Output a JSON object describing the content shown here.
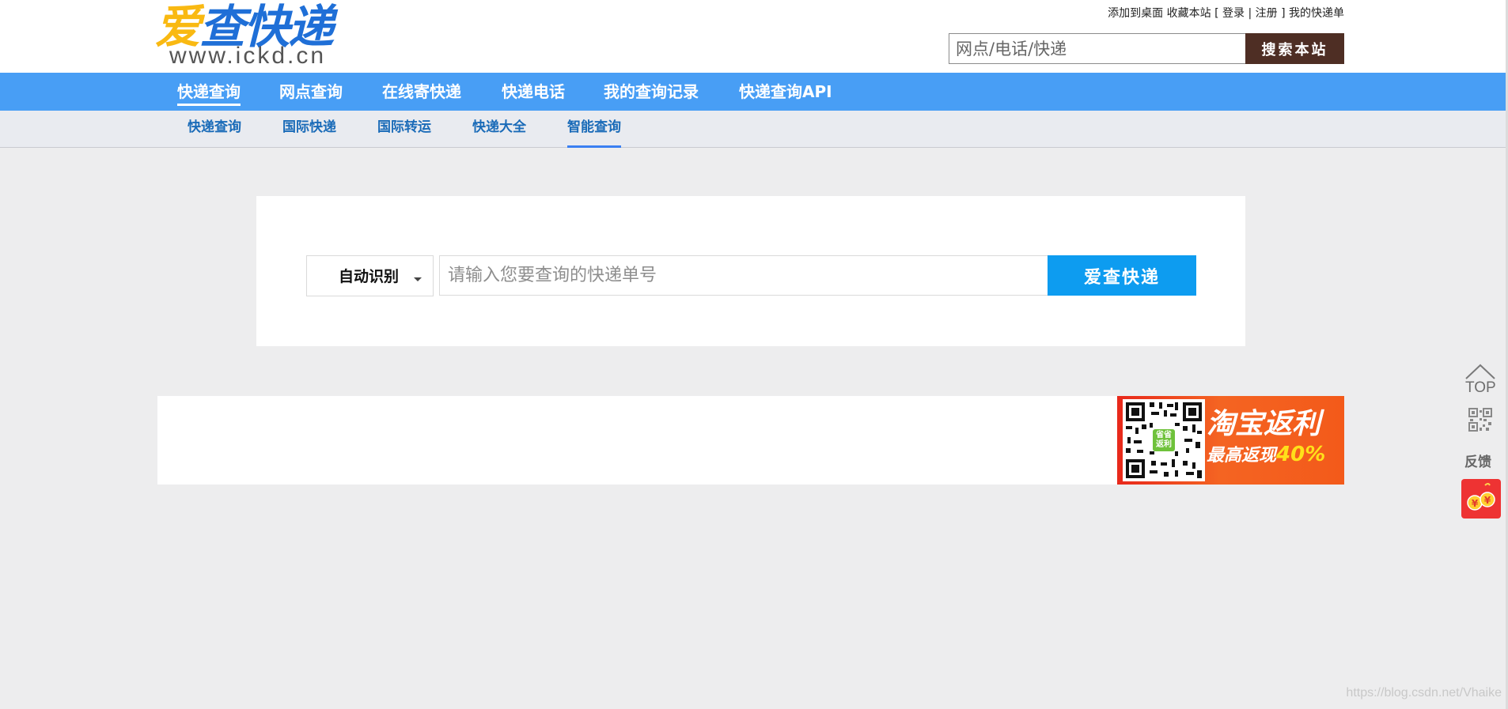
{
  "header": {
    "logo": {
      "name_first": "爱",
      "name_rest": "查快递",
      "url": "www.ickd.cn"
    },
    "top_links": {
      "add_desktop": "添加到桌面",
      "bookmark": "收藏本站",
      "bracket_open": "[",
      "login": "登录",
      "divider": "|",
      "register": "注册",
      "bracket_close": "]",
      "my_orders": "我的快递单"
    },
    "search": {
      "placeholder": "网点/电话/快递",
      "button_label": "搜索本站"
    }
  },
  "main_nav": {
    "items": [
      {
        "label": "快递查询",
        "active": true
      },
      {
        "label": "网点查询"
      },
      {
        "label": "在线寄快递"
      },
      {
        "label": "快递电话"
      },
      {
        "label": "我的查询记录"
      },
      {
        "label": "快递查询API"
      }
    ]
  },
  "sub_nav": {
    "items": [
      {
        "label": "快递查询"
      },
      {
        "label": "国际快递"
      },
      {
        "label": "国际转运"
      },
      {
        "label": "快递大全"
      },
      {
        "label": "智能查询",
        "active": true
      }
    ]
  },
  "query": {
    "carrier_selected": "自动识别",
    "tracking_placeholder": "请输入您要查询的快递单号",
    "submit_label": "爱查快递"
  },
  "banner_ad": {
    "title": "淘宝返利",
    "subtitle_prefix": "最高返现",
    "subtitle_percent": "40%",
    "qr_center_text": "省省返利"
  },
  "float_toolbar": {
    "top_label": "TOP",
    "feedback_label": "反馈"
  },
  "watermark": "https://blog.csdn.net/Vhaike",
  "colors": {
    "main_nav_bg": "#489ef5",
    "search_button_bg": "#4e2e24",
    "track_button_bg": "#0d9cf0",
    "logo_yellow": "#f9b912",
    "logo_blue": "#1f6fd7",
    "subnav_text": "#1a6bb8",
    "ad_orange": "#f46422"
  }
}
